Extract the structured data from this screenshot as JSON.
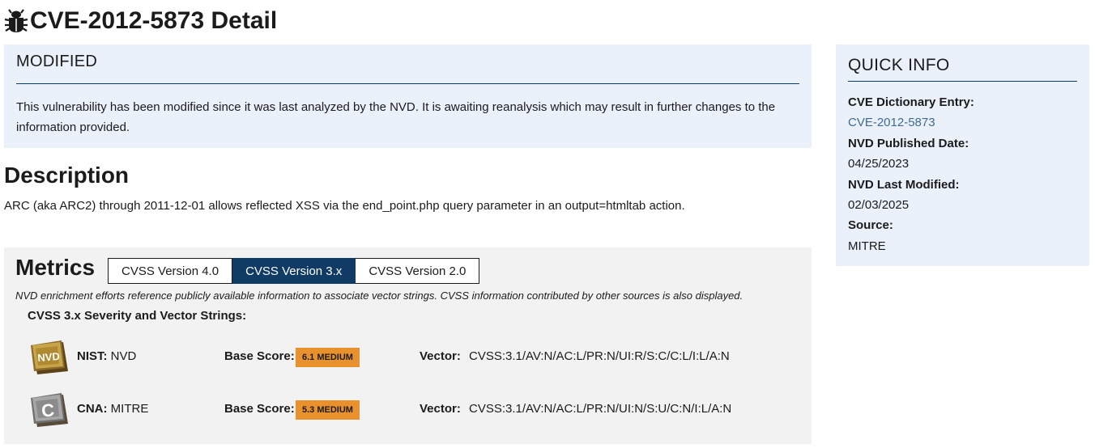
{
  "page": {
    "title": "CVE-2012-5873 Detail",
    "icon": "bug-icon"
  },
  "modified": {
    "heading": "MODIFIED",
    "text": "This vulnerability has been modified since it was last analyzed by the NVD. It is awaiting reanalysis which may result in further changes to the information provided."
  },
  "description": {
    "heading": "Description",
    "text": "ARC (aka ARC2) through 2011-12-01 allows reflected XSS via the end_point.php query parameter in an output=htmltab action."
  },
  "metrics": {
    "heading": "Metrics",
    "tabs": [
      {
        "label": "CVSS Version 4.0",
        "active": false
      },
      {
        "label": "CVSS Version 3.x",
        "active": true
      },
      {
        "label": "CVSS Version 2.0",
        "active": false
      }
    ],
    "note": "NVD enrichment efforts reference publicly available information to associate vector strings. CVSS information contributed by other sources is also displayed.",
    "subtitle": "CVSS 3.x Severity and Vector Strings:",
    "base_score_label": "Base Score:",
    "vector_label": "Vector:",
    "rows": [
      {
        "icon": "nvd-icon",
        "icon_text": "NVD",
        "source_type": "NIST:",
        "source_name": "NVD",
        "score": "6.1 MEDIUM",
        "vector": "CVSS:3.1/AV:N/AC:L/PR:N/UI:R/S:C/C:L/I:L/A:N"
      },
      {
        "icon": "cna-icon",
        "icon_text": "C",
        "source_type": "CNA:",
        "source_name": "MITRE",
        "score": "5.3 MEDIUM",
        "vector": "CVSS:3.1/AV:N/AC:L/PR:N/UI:N/S:U/C:N/I:L/A:N"
      }
    ],
    "severity_color": "#e8912d"
  },
  "quick_info": {
    "heading": "QUICK INFO",
    "dictionary_label": "CVE Dictionary Entry:",
    "dictionary_value": "CVE-2012-5873",
    "published_label": "NVD Published Date:",
    "published_value": "04/25/2023",
    "modified_label": "NVD Last Modified:",
    "modified_value": "02/03/2025",
    "source_label": "Source:",
    "source_value": "MITRE"
  },
  "colors": {
    "accent": "#0f3b64",
    "panel_blue": "#eaf1fb",
    "panel_gray": "#f1f2f1",
    "link": "#3f6b8f"
  }
}
